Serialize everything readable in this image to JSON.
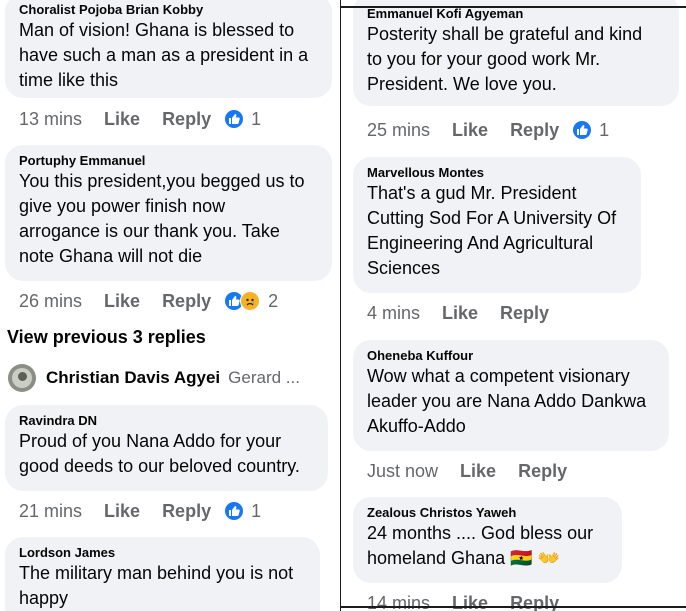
{
  "left": [
    {
      "author": "Choralist Pojoba Brian Kobby",
      "text": "Man of vision! Ghana is blessed to\nhave such a man as a president in a\ntime like this",
      "time": "13 mins",
      "like": "Like",
      "reply": "Reply",
      "reactions": [
        "like"
      ],
      "count": "1"
    },
    {
      "author": "Portuphy Emmanuel",
      "text": "You this president,you begged us to\ngive you power finish now\narrogance is our thank you. Take\nnote Ghana will not die",
      "time": "26 mins",
      "like": "Like",
      "reply": "Reply",
      "reactions": [
        "like",
        "sad"
      ],
      "count": "2"
    },
    {
      "author": "Ravindra DN",
      "text": "Proud of you Nana Addo for your\ngood deeds to our beloved country.",
      "time": "21 mins",
      "like": "Like",
      "reply": "Reply",
      "reactions": [
        "like"
      ],
      "count": "1"
    },
    {
      "author": "Lordson James",
      "text": "The military man behind you is not\nhappy"
    }
  ],
  "view_previous": "View previous 3 replies",
  "collapsed_reply": {
    "name": "Christian Davis Agyei",
    "preview": "Gerard ..."
  },
  "right": [
    {
      "author": "Emmanuel Kofi Agyeman",
      "text": "Posterity shall be grateful and kind\nto you for your good work Mr.\nPresident. We love you.",
      "time": "25 mins",
      "like": "Like",
      "reply": "Reply",
      "reactions": [
        "like"
      ],
      "count": "1"
    },
    {
      "author": "Marvellous Montes",
      "text": "That's a gud Mr. President\nCutting Sod For A University Of\nEngineering And Agricultural\nSciences",
      "time": "4 mins",
      "like": "Like",
      "reply": "Reply"
    },
    {
      "author": "Oheneba Kuffour",
      "text": "Wow what a competent visionary\nleader you are Nana Addo Dankwa\nAkuffo-Addo",
      "time": "Just now",
      "like": "Like",
      "reply": "Reply"
    },
    {
      "author": "Zealous Christos Yaweh",
      "text": "24 months .... God bless our\nhomeland Ghana 🇬🇭 👐",
      "time": "14 mins",
      "like": "Like",
      "reply": "Reply"
    }
  ],
  "colors": {
    "bubble": "#f0f2f5",
    "meta": "#65676b",
    "like_blue": "#1877f2"
  }
}
